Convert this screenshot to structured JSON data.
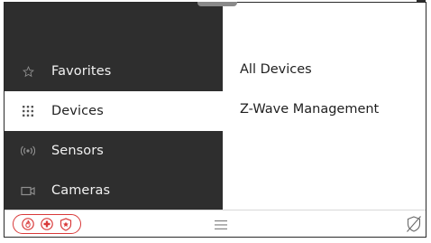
{
  "sidebar": {
    "items": [
      {
        "label": "Favorites",
        "icon": "star-icon"
      },
      {
        "label": "Devices",
        "icon": "grid-icon",
        "active": true
      },
      {
        "label": "Sensors",
        "icon": "sensor-icon"
      },
      {
        "label": "Cameras",
        "icon": "camera-icon"
      }
    ]
  },
  "content": {
    "items": [
      {
        "label": "All Devices"
      },
      {
        "label": "Z-Wave Management"
      }
    ]
  },
  "bottom_bar": {
    "emergency_icons": [
      "fire-icon",
      "medical-icon",
      "police-icon"
    ],
    "menu_icon": "menu-icon",
    "ai_icon": "no-ai-icon"
  },
  "colors": {
    "sidebar_bg": "#2e2e2e",
    "emergency_red": "#d93a3a"
  }
}
